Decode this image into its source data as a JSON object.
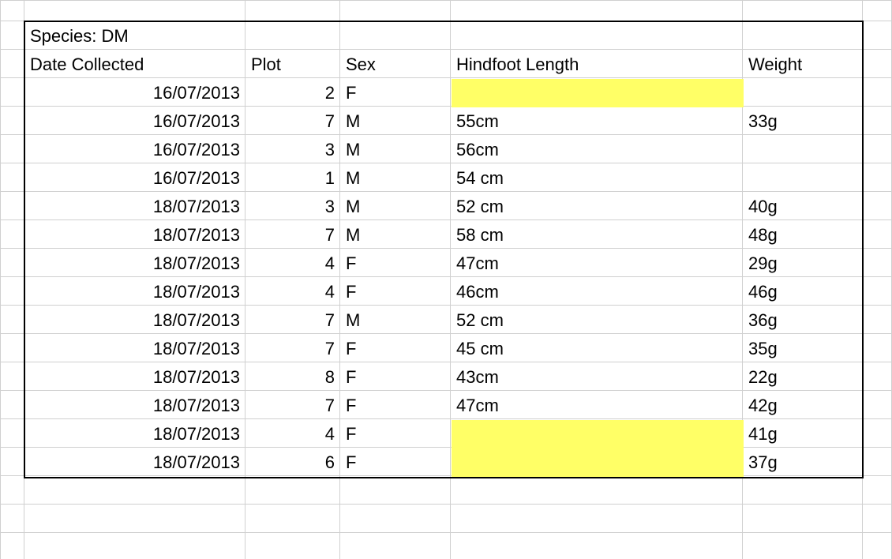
{
  "title_cell": "Species: DM",
  "headers": {
    "date": "Date Collected",
    "plot": "Plot",
    "sex": "Sex",
    "hindfoot": "Hindfoot Length",
    "weight": "Weight"
  },
  "rows": [
    {
      "date": "16/07/2013",
      "plot": "2",
      "sex": "F",
      "hindfoot": "",
      "weight": "",
      "hindfoot_hl": true
    },
    {
      "date": "16/07/2013",
      "plot": "7",
      "sex": "M",
      "hindfoot": "55cm",
      "weight": "33g"
    },
    {
      "date": "16/07/2013",
      "plot": "3",
      "sex": "M",
      "hindfoot": "56cm",
      "weight": ""
    },
    {
      "date": "16/07/2013",
      "plot": "1",
      "sex": "M",
      "hindfoot": "54 cm",
      "weight": ""
    },
    {
      "date": "18/07/2013",
      "plot": "3",
      "sex": "M",
      "hindfoot": "52 cm",
      "weight": "40g"
    },
    {
      "date": "18/07/2013",
      "plot": "7",
      "sex": "M",
      "hindfoot": "58 cm",
      "weight": "48g"
    },
    {
      "date": "18/07/2013",
      "plot": "4",
      "sex": "F",
      "hindfoot": "47cm",
      "weight": "29g"
    },
    {
      "date": "18/07/2013",
      "plot": "4",
      "sex": "F",
      "hindfoot": "46cm",
      "weight": "46g"
    },
    {
      "date": "18/07/2013",
      "plot": "7",
      "sex": "M",
      "hindfoot": "52 cm",
      "weight": "36g"
    },
    {
      "date": "18/07/2013",
      "plot": "7",
      "sex": "F",
      "hindfoot": "45 cm",
      "weight": "35g"
    },
    {
      "date": "18/07/2013",
      "plot": "8",
      "sex": "F",
      "hindfoot": "43cm",
      "weight": "22g"
    },
    {
      "date": "18/07/2013",
      "plot": "7",
      "sex": "F",
      "hindfoot": "47cm",
      "weight": "42g"
    },
    {
      "date": "18/07/2013",
      "plot": "4",
      "sex": "F",
      "hindfoot": "",
      "weight": "41g",
      "hindfoot_hl": true
    },
    {
      "date": "18/07/2013",
      "plot": "6",
      "sex": "F",
      "hindfoot": "",
      "weight": "37g",
      "hindfoot_hl": true
    }
  ],
  "colors": {
    "highlight": "#ffff66",
    "gridline": "#d0d0d0"
  }
}
